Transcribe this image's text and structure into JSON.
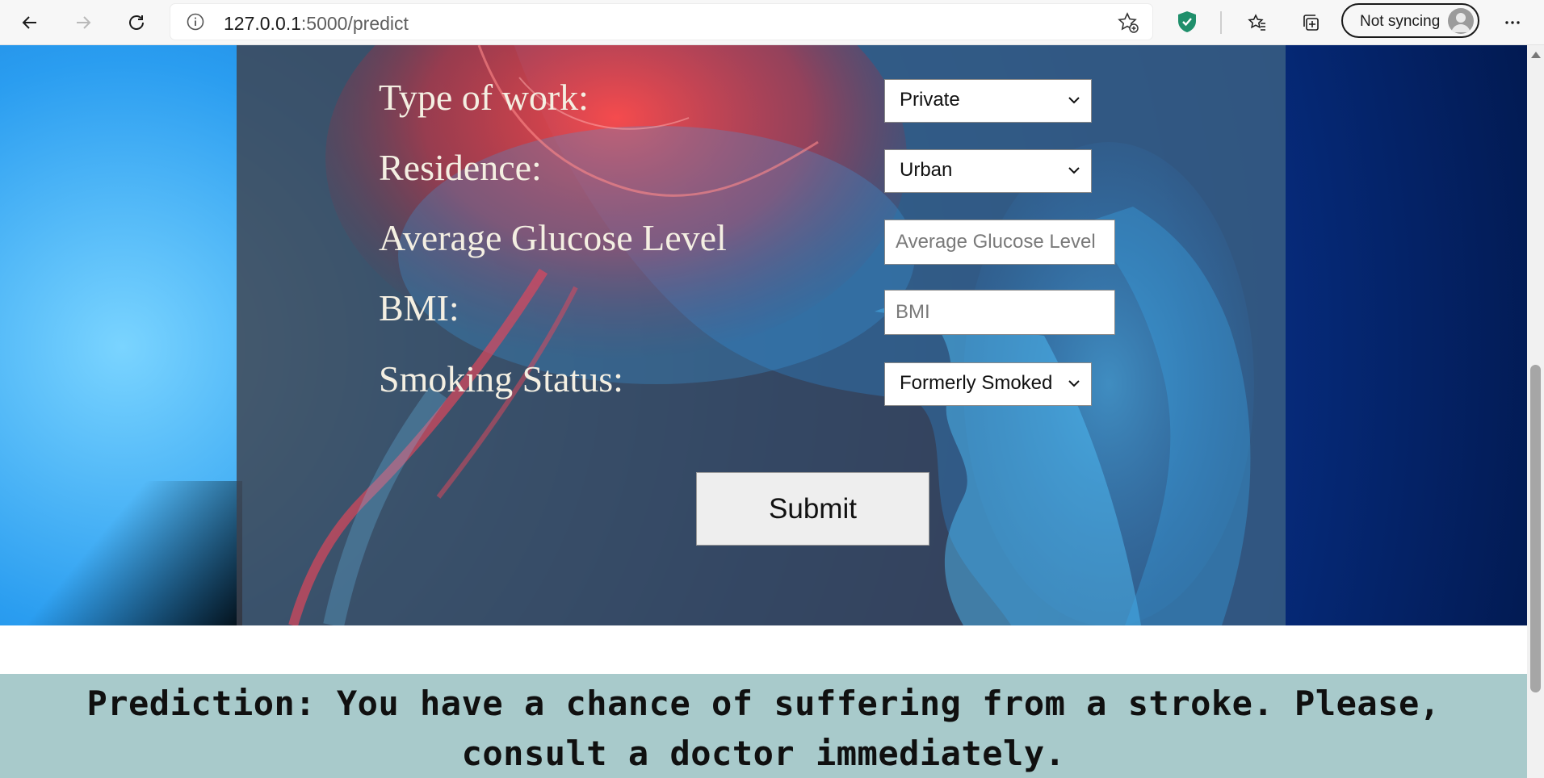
{
  "browser": {
    "url_host": "127.0.0.1",
    "url_path": ":5000/predict",
    "sync_label": "Not syncing"
  },
  "form": {
    "work_type": {
      "label": "Type of work:",
      "value": "Private"
    },
    "residence": {
      "label": "Residence:",
      "value": "Urban"
    },
    "glucose": {
      "label": "Average Glucose Level",
      "placeholder": "Average Glucose Level"
    },
    "bmi": {
      "label": "BMI:",
      "placeholder": "BMI"
    },
    "smoking": {
      "label": "Smoking Status:",
      "value": "Formerly Smoked"
    },
    "submit_label": "Submit"
  },
  "result": {
    "message": "Prediction: You have a chance of suffering from a stroke. Please, consult a doctor immediately."
  }
}
